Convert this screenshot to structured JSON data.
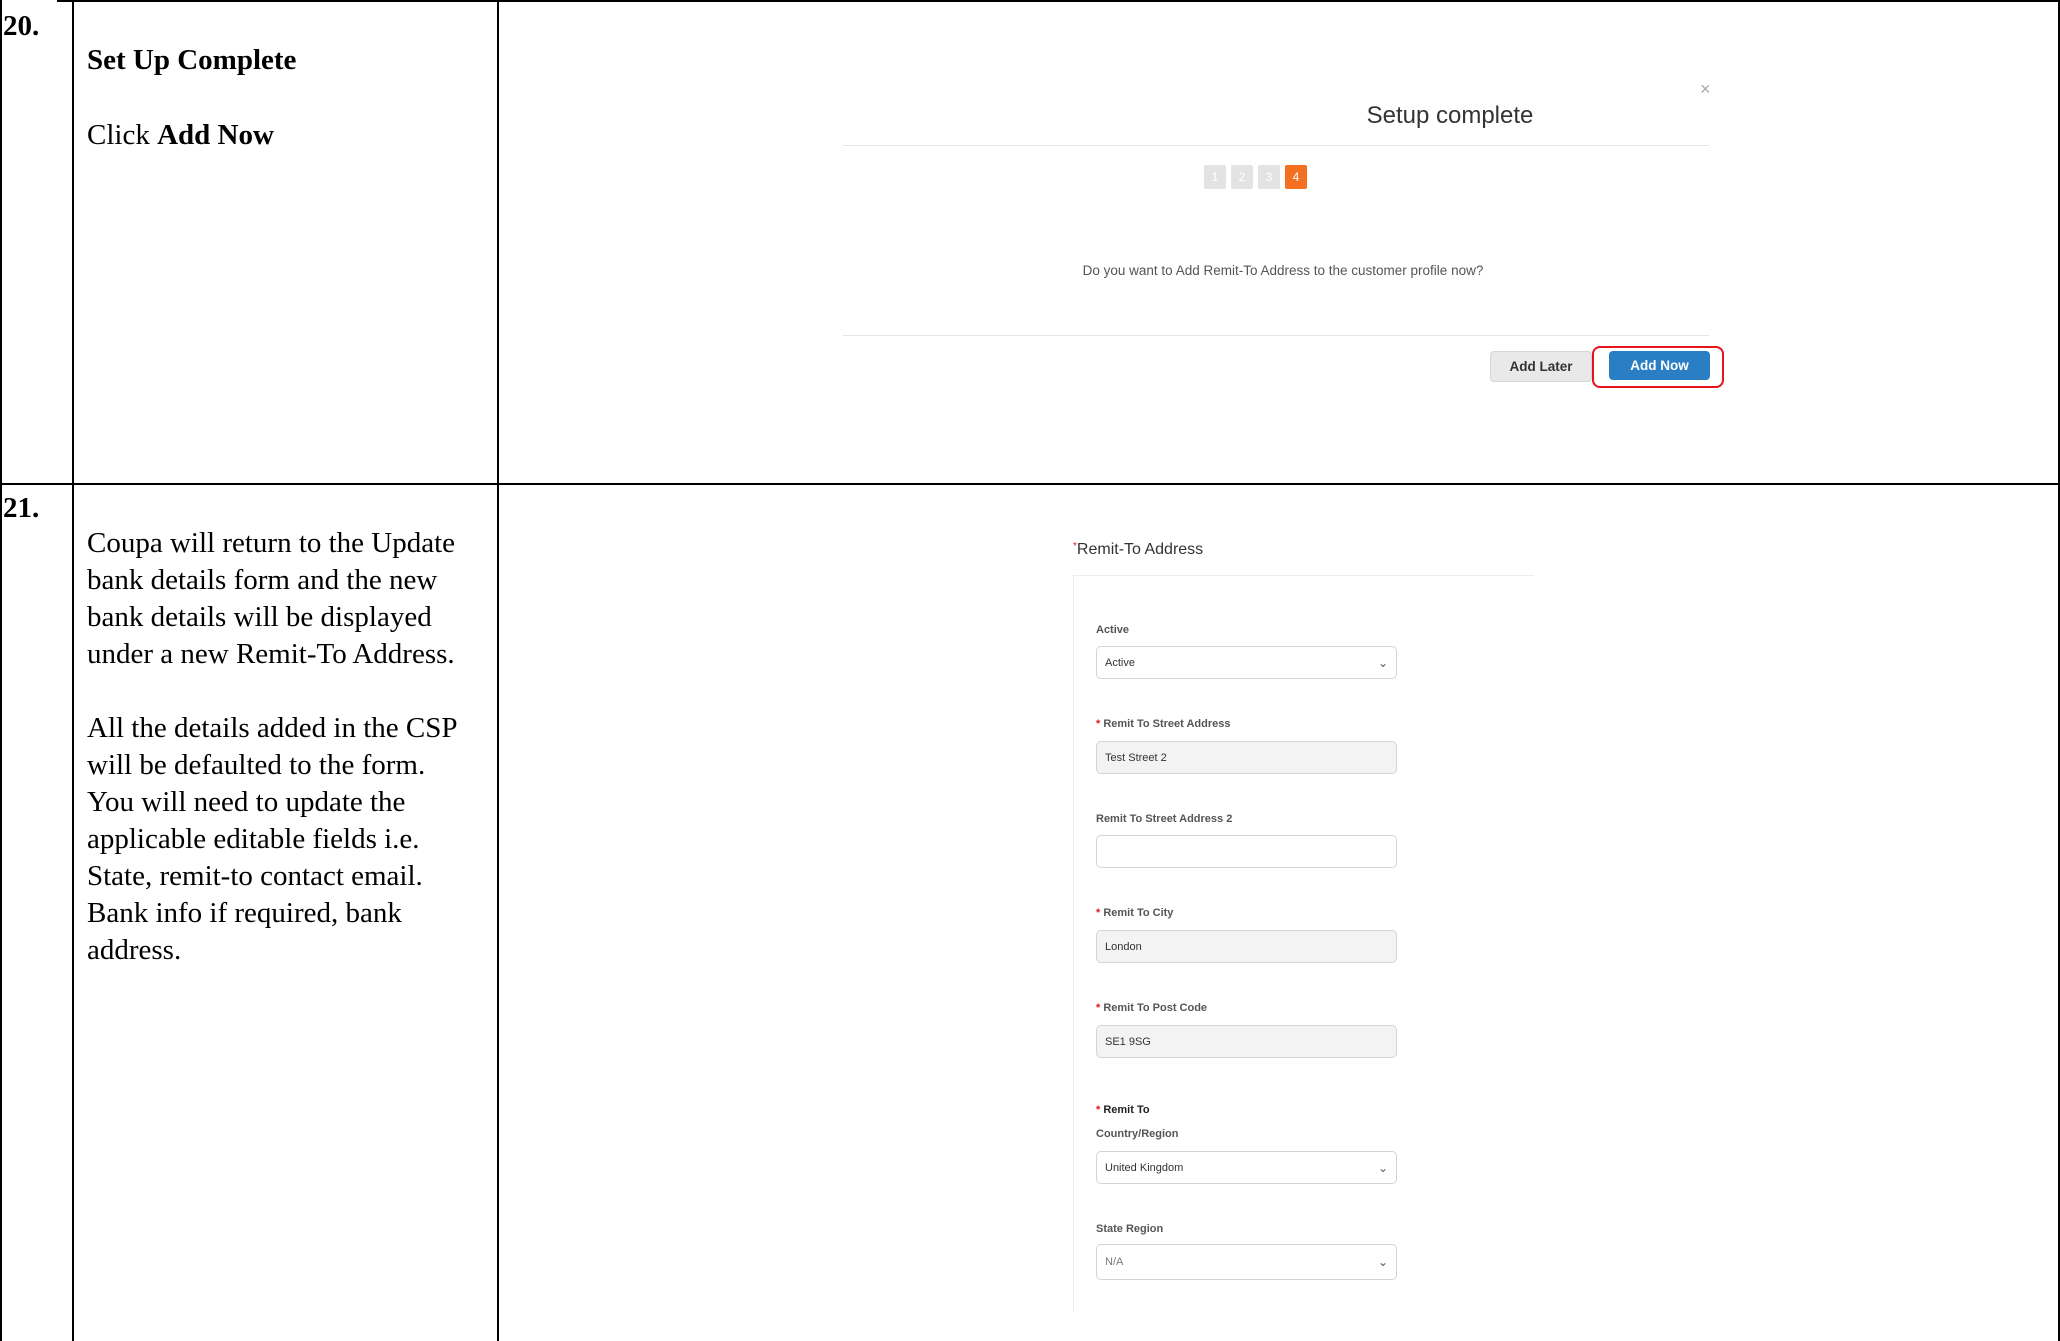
{
  "row20": {
    "number": "20.",
    "title": "Set Up Complete",
    "instruction_prefix": "Click ",
    "instruction_bold": "Add Now",
    "modal": {
      "title": "Setup complete",
      "close": "×",
      "steps": [
        "1",
        "2",
        "3",
        "4"
      ],
      "active_step": "4",
      "question": "Do you want to Add Remit-To Address to the customer profile now?",
      "add_later": "Add Later",
      "add_now": "Add Now",
      "highlight_color": "#e8141c"
    }
  },
  "row21": {
    "number": "21.",
    "para1": "Coupa will return to the Update bank details form and the new bank details will be displayed under a new Remit-To Address.",
    "para2": "All the details added in the CSP will be defaulted to the form.",
    "para3": "You will need to update the applicable editable fields i.e. State, remit-to contact email. Bank info if required, bank address.",
    "form": {
      "section_title": "Remit-To Address",
      "active_label": "Active",
      "active_value": "Active",
      "street_label": "Remit To Street Address",
      "street_value": "Test Street 2",
      "street2_label": "Remit To Street Address 2",
      "street2_value": "",
      "city_label": "Remit To City",
      "city_value": "London",
      "postcode_label": "Remit To Post Code",
      "postcode_value": "SE1 9SG",
      "country_label_1": "Remit To",
      "country_label_2": "Country/Region",
      "country_value": "United Kingdom",
      "state_label": "State Region",
      "state_value": "N/A",
      "required_marker": "*"
    }
  },
  "colors": {
    "accent_blue": "#2a7fc4",
    "step_orange": "#f37021",
    "required_red": "#e8141c"
  }
}
